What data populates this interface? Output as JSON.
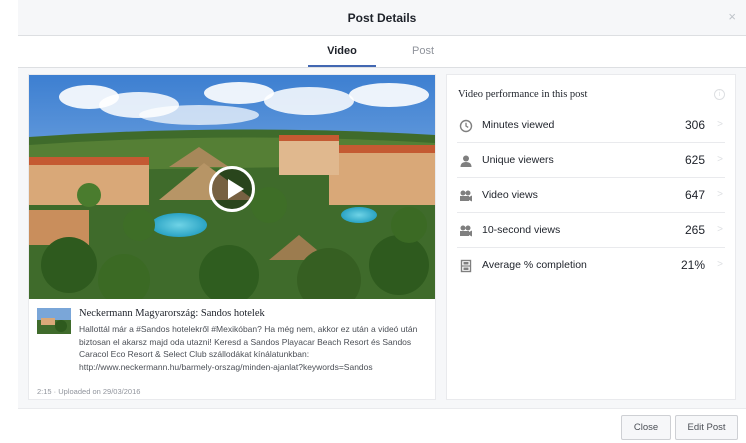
{
  "dialog": {
    "title": "Post Details",
    "close_glyph": "×"
  },
  "tabs": [
    {
      "label": "Video",
      "active": true
    },
    {
      "label": "Post",
      "active": false
    }
  ],
  "video": {
    "page_name": "Neckermann Magyarország: Sandos hotelek",
    "post_text": "Hallottál már a #Sandos hotelekről #Mexikóban? Ha még nem, akkor ez után a videó után biztosan el akarsz majd oda utazni! Keresd a Sandos Playacar Beach Resort és Sandos Caracol Eco Resort & Select Club szállodákat kínálatunkban: http://www.neckermann.hu/barmely-orszag/minden-ajanlat?keywords=Sandos",
    "meta": "2:15  ·  Uploaded on 29/03/2016"
  },
  "performance": {
    "title": "Video performance in this post",
    "info_glyph": "i",
    "chevron_glyph": ">",
    "rows": [
      {
        "icon": "clock-icon",
        "label": "Minutes viewed",
        "value": "306"
      },
      {
        "icon": "person-icon",
        "label": "Unique viewers",
        "value": "625"
      },
      {
        "icon": "video-views-icon",
        "label": "Video views",
        "value": "647"
      },
      {
        "icon": "video-10s-icon",
        "label": "10-second views",
        "value": "265"
      },
      {
        "icon": "film-strip-icon",
        "label": "Average % completion",
        "value": "21%"
      }
    ]
  },
  "footer": {
    "close_label": "Close",
    "edit_label": "Edit Post"
  }
}
